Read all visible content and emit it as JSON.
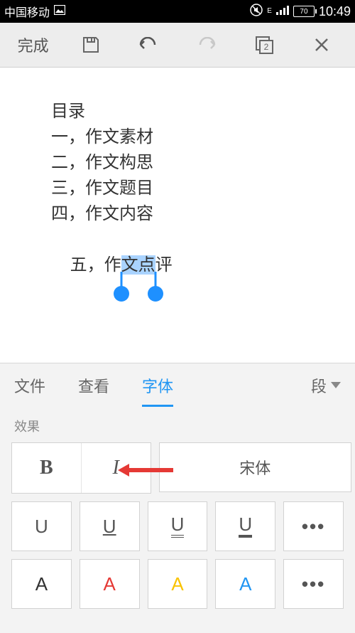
{
  "status": {
    "carrier": "中国移动",
    "battery_pct": "70",
    "time": "10:49",
    "network_label": "E"
  },
  "toolbar": {
    "done": "完成",
    "page_count": "2"
  },
  "doc": {
    "lines": [
      "目录",
      "一，作文素材",
      "二，作文构思",
      "三，作文题目",
      "四，作文内容"
    ],
    "last_line_pre": "五，作",
    "last_line_sel": "文点",
    "last_line_post": "评"
  },
  "tabs": {
    "file": "文件",
    "view": "查看",
    "font": "字体",
    "paragraph": "段"
  },
  "panel": {
    "section": "效果",
    "bold": "B",
    "italic": "I",
    "font_name": "宋体",
    "u": "U",
    "a": "A",
    "dots": "•••",
    "colors": {
      "black": "#333333",
      "red": "#e53935",
      "yellow": "#f9c300",
      "blue": "#2196f3"
    }
  }
}
